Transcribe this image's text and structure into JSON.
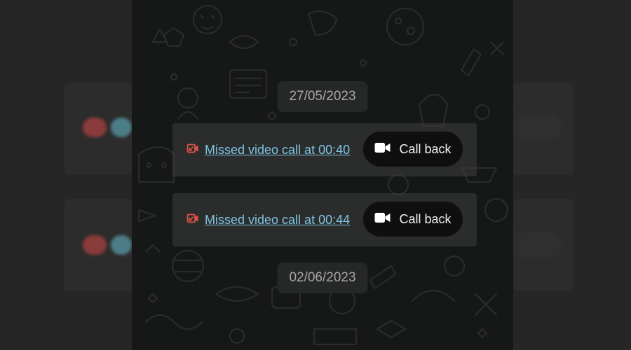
{
  "dates": [
    "27/05/2023",
    "02/06/2023"
  ],
  "calls": [
    {
      "text": "Missed video call at 00:40",
      "action": "Call back",
      "icon": "missed-video-call-icon",
      "action_icon": "video-camera-icon"
    },
    {
      "text": "Missed video call at 00:44",
      "action": "Call back",
      "icon": "missed-video-call-icon",
      "action_icon": "video-camera-icon"
    }
  ],
  "colors": {
    "missed": "#e0534a",
    "link": "#7fc4e4",
    "chip_bg": "#262727",
    "chat_bg": "#161717",
    "button_bg": "#0f0f0f"
  }
}
